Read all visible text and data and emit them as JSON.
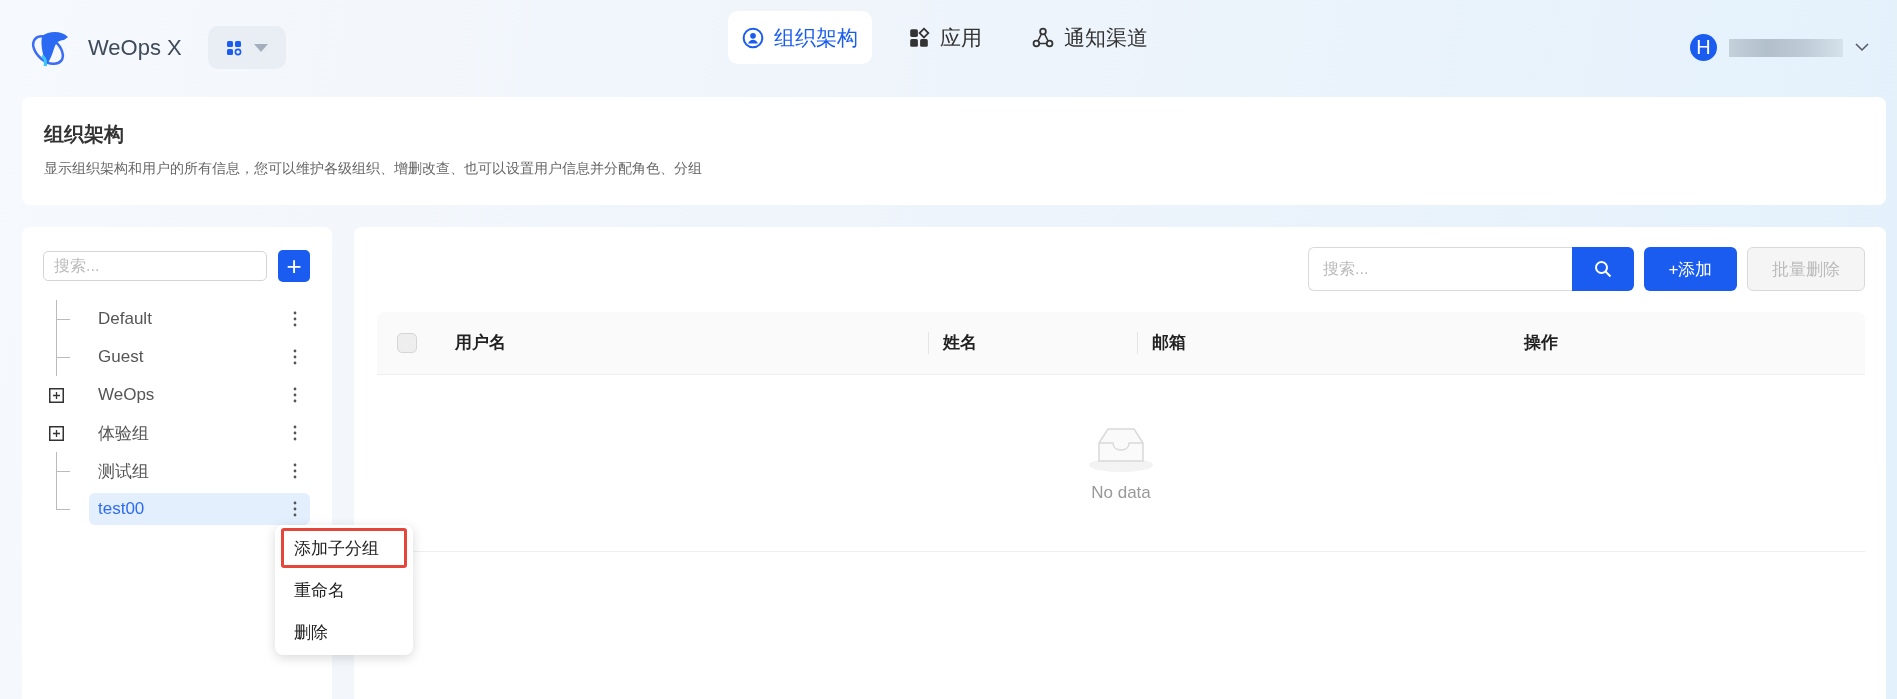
{
  "app": {
    "name": "WeOps X"
  },
  "nav": [
    {
      "label": "组织架构",
      "selected": true
    },
    {
      "label": "应用",
      "selected": false
    },
    {
      "label": "通知渠道",
      "selected": false
    }
  ],
  "user": {
    "avatar": "H"
  },
  "page_header": {
    "title": "组织架构",
    "description": "显示组织架构和用户的所有信息，您可以维护各级组织、增删改查、也可以设置用户信息并分配角色、分组"
  },
  "tree": {
    "search": {
      "placeholder": "搜索..."
    },
    "add_button": "+",
    "items": [
      {
        "label": "Default",
        "kind": "leaf",
        "selected": false
      },
      {
        "label": "Guest",
        "kind": "leaf",
        "selected": false
      },
      {
        "label": "WeOps",
        "kind": "folder",
        "expanded": false,
        "selected": false
      },
      {
        "label": "体验组",
        "kind": "folder",
        "expanded": false,
        "selected": false
      },
      {
        "label": "测试组",
        "kind": "leaf",
        "selected": false
      },
      {
        "label": "test00",
        "kind": "leaf",
        "selected": true
      }
    ]
  },
  "context_menu": [
    {
      "label": "添加子分组",
      "highlighted": true
    },
    {
      "label": "重命名",
      "highlighted": false
    },
    {
      "label": "删除",
      "highlighted": false
    }
  ],
  "toolbar": {
    "search": {
      "placeholder": "搜索..."
    },
    "add_button": "+添加",
    "batch_delete": {
      "label": "批量删除",
      "disabled": true
    }
  },
  "table": {
    "columns": [
      "用户名",
      "姓名",
      "邮箱",
      "操作"
    ],
    "select_all": {
      "checked": false
    },
    "empty_text": "No data"
  }
}
